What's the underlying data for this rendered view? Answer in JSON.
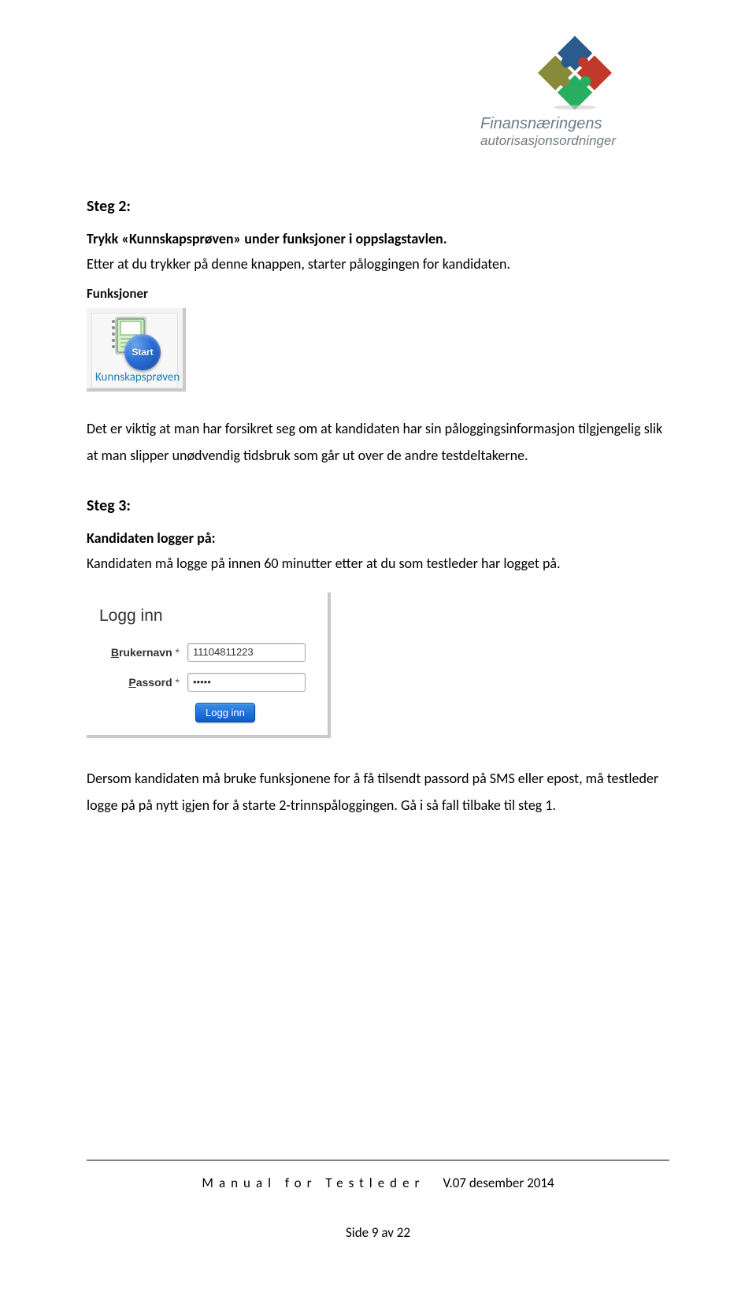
{
  "logo": {
    "line1": "Finansnæringens",
    "line2": "autorisasjonsordninger"
  },
  "steg2": {
    "title": "Steg 2:",
    "sub": "Trykk «Kunnskapsprøven» under funksjoner i oppslagstavlen.",
    "desc": "Etter at du trykker på denne knappen, starter påloggingen for kandidaten."
  },
  "funksjoner": {
    "heading": "Funksjoner",
    "start_label": "Start",
    "link_label": "Kunnskapsprøven"
  },
  "para_mid": "Det er viktig at man har forsikret seg om at kandidaten har sin påloggingsinformasjon tilgjengelig slik at man slipper unødvendig tidsbruk som går ut over de andre testdeltakerne.",
  "steg3": {
    "title": "Steg 3:",
    "sub": "Kandidaten logger på:",
    "desc": "Kandidaten må logge på innen 60 minutter etter at du som testleder har logget på."
  },
  "login": {
    "heading": "Logg inn",
    "user_label_u": "B",
    "user_label_rest": "rukernavn",
    "user_value": "11104811223",
    "pass_label_u": "P",
    "pass_label_rest": "assord",
    "pass_value": "•••••",
    "button": "Logg inn"
  },
  "para_bottom": "Dersom kandidaten må bruke funksjonene for å få tilsendt passord på SMS eller epost, må testleder logge på på nytt igjen for å starte 2-trinnspåloggingen. Gå i så fall tilbake til steg 1.",
  "footer": {
    "manual": "Manual for Testleder",
    "version": "V.07 desember 2014",
    "page": "Side 9 av 22"
  }
}
